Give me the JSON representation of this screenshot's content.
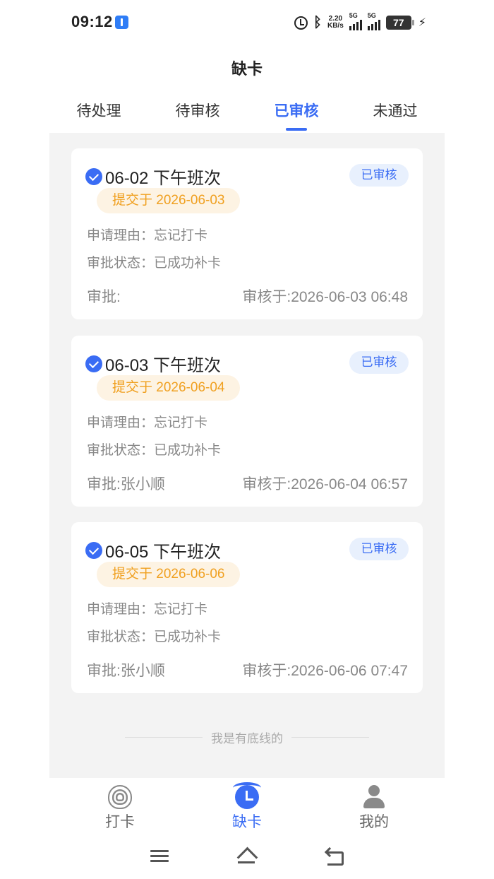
{
  "status_bar": {
    "time": "09:12",
    "net_speed_value": "2.20",
    "net_speed_unit": "KB/s",
    "signal_1": "5G",
    "signal_2": "5G",
    "battery": "77"
  },
  "header": {
    "title": "缺卡"
  },
  "tabs": [
    {
      "label": "待处理",
      "active": false
    },
    {
      "label": "待审核",
      "active": false
    },
    {
      "label": "已审核",
      "active": true
    },
    {
      "label": "未通过",
      "active": false
    }
  ],
  "records": [
    {
      "title": "06-02 下午班次",
      "status_badge": "已审核",
      "submitted": "提交于 2026-06-03",
      "reason": "申请理由：忘记打卡",
      "approval_status": "审批状态：已成功补卡",
      "approver": "审批:",
      "reviewed_at": "审核于:2026-06-03 06:48"
    },
    {
      "title": "06-03 下午班次",
      "status_badge": "已审核",
      "submitted": "提交于 2026-06-04",
      "reason": "申请理由：忘记打卡",
      "approval_status": "审批状态：已成功补卡",
      "approver": "审批:张小顺",
      "reviewed_at": "审核于:2026-06-04 06:57"
    },
    {
      "title": "06-05 下午班次",
      "status_badge": "已审核",
      "submitted": "提交于 2026-06-06",
      "reason": "申请理由：忘记打卡",
      "approval_status": "审批状态：已成功补卡",
      "approver": "审批:张小顺",
      "reviewed_at": "审核于:2026-06-06 07:47"
    }
  ],
  "end_text": "我是有底线的",
  "bottom_nav": [
    {
      "label": "打卡",
      "icon": "fingerprint-icon",
      "active": false
    },
    {
      "label": "缺卡",
      "icon": "alarm-clock-icon",
      "active": true
    },
    {
      "label": "我的",
      "icon": "person-icon",
      "active": false
    }
  ],
  "colors": {
    "accent": "#3a6cf4",
    "badge_bg": "#e8f0fd",
    "pill_text": "#f0a020",
    "pill_bg": "#fdf3e3",
    "content_bg": "#f3f3f3"
  }
}
